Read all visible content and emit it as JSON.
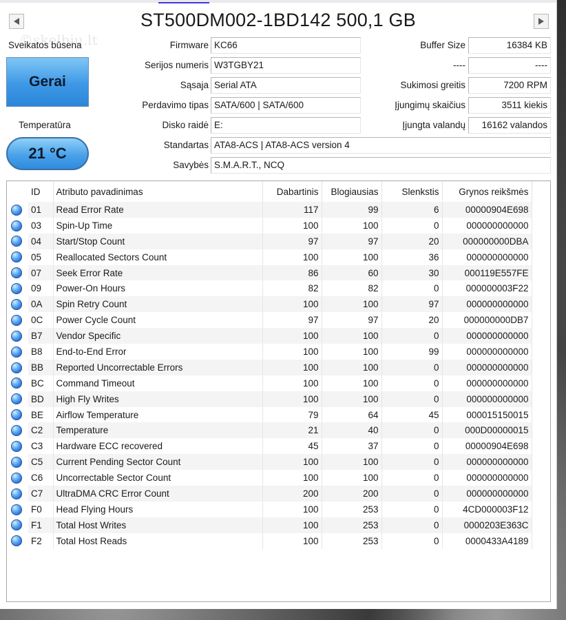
{
  "drive": {
    "title": "ST500DM002-1BD142 500,1 GB"
  },
  "watermark": "©skelbiu.lt",
  "health": {
    "label": "Sveikatos būsena",
    "status": "Gerai",
    "status_color": "#3e98e6"
  },
  "temperature": {
    "label": "Temperatūra",
    "value": "21 °C"
  },
  "info_left": {
    "firmware_label": "Firmware",
    "firmware": "KC66",
    "serial_label": "Serijos numeris",
    "serial": "W3TGBY21",
    "interface_label": "Sąsaja",
    "interface": "Serial ATA",
    "transfer_label": "Perdavimo tipas",
    "transfer": "SATA/600 | SATA/600",
    "drive_letter_label": "Disko raidė",
    "drive_letter": "E:",
    "standard_label": "Standartas",
    "standard": "ATA8-ACS | ATA8-ACS version 4",
    "features_label": "Savybės",
    "features": "S.M.A.R.T., NCQ"
  },
  "info_right": {
    "buffer_label": "Buffer Size",
    "buffer": "16384 KB",
    "blank_label": "----",
    "blank_value": "----",
    "rotation_label": "Sukimosi greitis",
    "rotation": "7200 RPM",
    "power_count_label": "Įjungimų skaičius",
    "power_count": "3511 kiekis",
    "power_hours_label": "Įjungta valandų",
    "power_hours": "16162 valandos"
  },
  "nav": {
    "prev_icon": "triangle-left-icon",
    "next_icon": "triangle-right-icon"
  },
  "table": {
    "headers": {
      "id": "ID",
      "name": "Atributo pavadinimas",
      "current": "Dabartinis",
      "worst": "Blogiausias",
      "threshold": "Slenkstis",
      "raw": "Grynos reikšmės"
    },
    "status_dot_color": "#2f78d8",
    "rows": [
      {
        "id": "01",
        "name": "Read Error Rate",
        "current": "117",
        "worst": "99",
        "threshold": "6",
        "raw": "00000904E698"
      },
      {
        "id": "03",
        "name": "Spin-Up Time",
        "current": "100",
        "worst": "100",
        "threshold": "0",
        "raw": "000000000000"
      },
      {
        "id": "04",
        "name": "Start/Stop Count",
        "current": "97",
        "worst": "97",
        "threshold": "20",
        "raw": "000000000DBA"
      },
      {
        "id": "05",
        "name": "Reallocated Sectors Count",
        "current": "100",
        "worst": "100",
        "threshold": "36",
        "raw": "000000000000"
      },
      {
        "id": "07",
        "name": "Seek Error Rate",
        "current": "86",
        "worst": "60",
        "threshold": "30",
        "raw": "000119E557FE"
      },
      {
        "id": "09",
        "name": "Power-On Hours",
        "current": "82",
        "worst": "82",
        "threshold": "0",
        "raw": "000000003F22"
      },
      {
        "id": "0A",
        "name": "Spin Retry Count",
        "current": "100",
        "worst": "100",
        "threshold": "97",
        "raw": "000000000000"
      },
      {
        "id": "0C",
        "name": "Power Cycle Count",
        "current": "97",
        "worst": "97",
        "threshold": "20",
        "raw": "000000000DB7"
      },
      {
        "id": "B7",
        "name": "Vendor Specific",
        "current": "100",
        "worst": "100",
        "threshold": "0",
        "raw": "000000000000"
      },
      {
        "id": "B8",
        "name": "End-to-End Error",
        "current": "100",
        "worst": "100",
        "threshold": "99",
        "raw": "000000000000"
      },
      {
        "id": "BB",
        "name": "Reported Uncorrectable Errors",
        "current": "100",
        "worst": "100",
        "threshold": "0",
        "raw": "000000000000"
      },
      {
        "id": "BC",
        "name": "Command Timeout",
        "current": "100",
        "worst": "100",
        "threshold": "0",
        "raw": "000000000000"
      },
      {
        "id": "BD",
        "name": "High Fly Writes",
        "current": "100",
        "worst": "100",
        "threshold": "0",
        "raw": "000000000000"
      },
      {
        "id": "BE",
        "name": "Airflow Temperature",
        "current": "79",
        "worst": "64",
        "threshold": "45",
        "raw": "000015150015"
      },
      {
        "id": "C2",
        "name": "Temperature",
        "current": "21",
        "worst": "40",
        "threshold": "0",
        "raw": "000D00000015"
      },
      {
        "id": "C3",
        "name": "Hardware ECC recovered",
        "current": "45",
        "worst": "37",
        "threshold": "0",
        "raw": "00000904E698"
      },
      {
        "id": "C5",
        "name": "Current Pending Sector Count",
        "current": "100",
        "worst": "100",
        "threshold": "0",
        "raw": "000000000000"
      },
      {
        "id": "C6",
        "name": "Uncorrectable Sector Count",
        "current": "100",
        "worst": "100",
        "threshold": "0",
        "raw": "000000000000"
      },
      {
        "id": "C7",
        "name": "UltraDMA CRC Error Count",
        "current": "200",
        "worst": "200",
        "threshold": "0",
        "raw": "000000000000"
      },
      {
        "id": "F0",
        "name": "Head Flying Hours",
        "current": "100",
        "worst": "253",
        "threshold": "0",
        "raw": "4CD000003F12"
      },
      {
        "id": "F1",
        "name": "Total Host Writes",
        "current": "100",
        "worst": "253",
        "threshold": "0",
        "raw": "0000203E363C"
      },
      {
        "id": "F2",
        "name": "Total Host Reads",
        "current": "100",
        "worst": "253",
        "threshold": "0",
        "raw": "0000433A4189"
      }
    ]
  }
}
